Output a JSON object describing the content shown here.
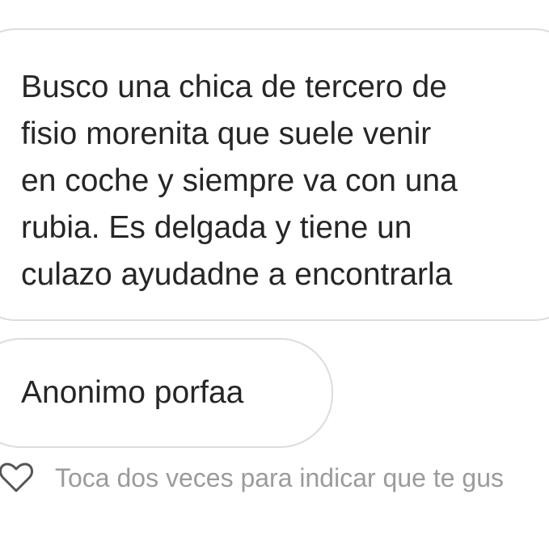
{
  "messages": [
    {
      "text": "Busco una chica de tercero de\nfisio morenita que suele venir\nen coche y siempre va con una\nrubia. Es delgada y tiene un\nculazo ayudadne a encontrarla"
    },
    {
      "text": "Anonimo porfaa"
    }
  ],
  "like_hint": "Toca dos veces para indicar que te gus",
  "icons": {
    "like": "heart-outline-icon"
  },
  "colors": {
    "bubble_border": "#dcdcdc",
    "message_text": "#262626",
    "hint_text": "#9b9b9b"
  }
}
